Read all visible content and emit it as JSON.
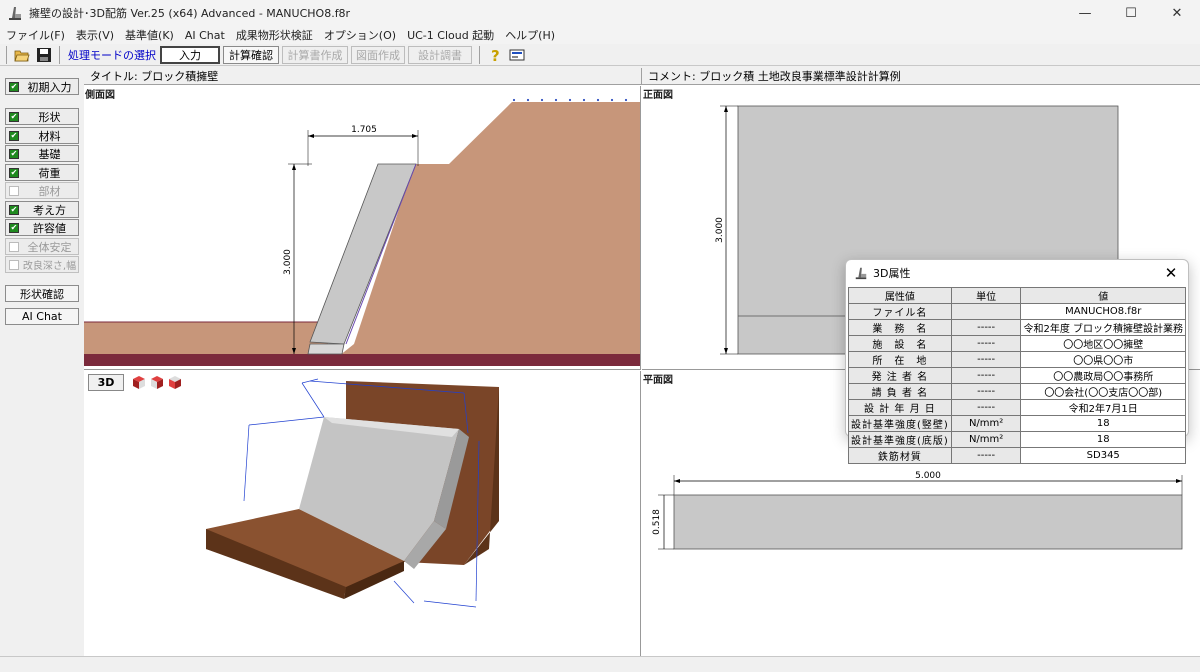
{
  "window": {
    "title": "擁壁の設計･3D配筋 Ver.25 (x64) Advanced  - MANUCHO8.f8r",
    "minimize": "—",
    "maximize": "☐",
    "close": "✕"
  },
  "menu": [
    "ファイル(F)",
    "表示(V)",
    "基準値(K)",
    "AI Chat",
    "成果物形状検証",
    "オプション(O)",
    "UC-1 Cloud 起動",
    "ヘルプ(H)"
  ],
  "toolbar": {
    "mode_label": "処理モードの選択",
    "buttons": [
      {
        "label": "入力",
        "state": "active"
      },
      {
        "label": "計算確認",
        "state": "enabled"
      },
      {
        "label": "計算書作成",
        "state": "disabled"
      },
      {
        "label": "図面作成",
        "state": "disabled"
      },
      {
        "label": "設計調書",
        "state": "disabled"
      }
    ]
  },
  "sidebar": {
    "initial_input": "初期入力",
    "items": [
      {
        "label": "形状",
        "enabled": true
      },
      {
        "label": "材料",
        "enabled": true
      },
      {
        "label": "基礎",
        "enabled": true
      },
      {
        "label": "荷重",
        "enabled": true
      },
      {
        "label": "部材",
        "enabled": false
      },
      {
        "label": "考え方",
        "enabled": true
      },
      {
        "label": "許容値",
        "enabled": true
      },
      {
        "label": "全体安定",
        "enabled": false
      },
      {
        "label": "改良深さ,幅",
        "enabled": false
      }
    ],
    "shape_check": "形状確認",
    "ai_chat": "AI Chat"
  },
  "infobar": {
    "title_text": "タイトル: ブロック積擁壁",
    "comment_text": "コメント: ブロック積 土地改良事業標準設計計算例"
  },
  "panes": {
    "side_view": {
      "label": "側面図",
      "dim_width": "1.705",
      "dim_height": "3.000"
    },
    "front_view": {
      "label": "正面図",
      "dim_height": "3.000"
    },
    "view3d": {
      "button": "3D"
    },
    "plan_view": {
      "label": "平面図",
      "dim_width": "5.000",
      "dim_height": "0.518"
    }
  },
  "dialog": {
    "title": "3D属性",
    "close": "✕",
    "headers": [
      "属性値",
      "単位",
      "値"
    ],
    "rows": [
      {
        "name": "ファイル名",
        "unit": "",
        "value": "MANUCHO8.f8r"
      },
      {
        "name": "業　務　名",
        "unit": "-----",
        "value": "令和2年度 ブロック積擁壁設計業務"
      },
      {
        "name": "施　設　名",
        "unit": "-----",
        "value": "〇〇地区〇〇擁壁"
      },
      {
        "name": "所　在　地",
        "unit": "-----",
        "value": "〇〇県〇〇市"
      },
      {
        "name": "発 注 者 名",
        "unit": "-----",
        "value": "〇〇農政局〇〇事務所"
      },
      {
        "name": "請 負 者 名",
        "unit": "-----",
        "value": "〇〇会社(〇〇支店〇〇部)"
      },
      {
        "name": "設 計 年 月 日",
        "unit": "-----",
        "value": "令和2年7月1日"
      },
      {
        "name": "設計基準強度(竪壁)",
        "unit": "N/mm²",
        "value": "18"
      },
      {
        "name": "設計基準強度(底版)",
        "unit": "N/mm²",
        "value": "18"
      },
      {
        "name": "鉄筋材質",
        "unit": "-----",
        "value": "SD345"
      }
    ]
  },
  "colors": {
    "soil": "#c7967a",
    "ground_line": "#7b2a3c",
    "wall": "#c8c8c8",
    "accent_blue": "#0000c8",
    "check_green": "#1f8a1f"
  }
}
